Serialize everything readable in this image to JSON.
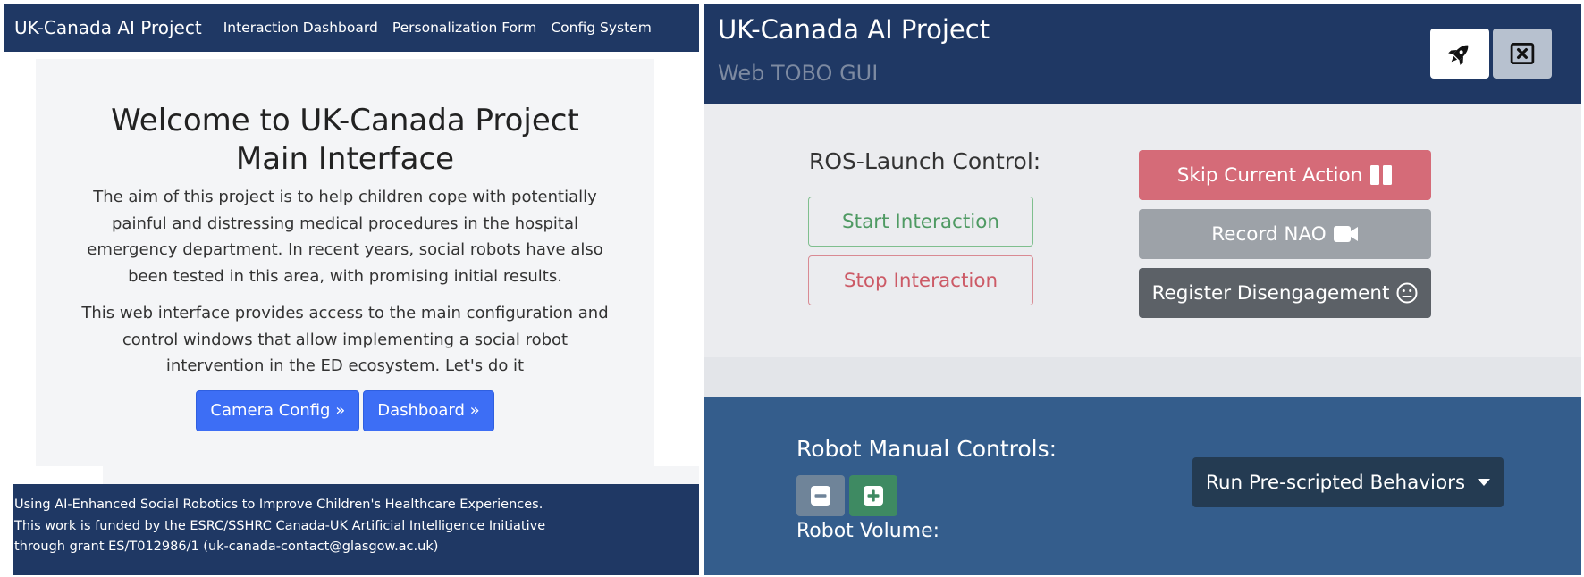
{
  "left": {
    "navbar": {
      "brand": "UK-Canada AI Project",
      "links": [
        "Interaction Dashboard",
        "Personalization Form",
        "Config System"
      ]
    },
    "jumbotron": {
      "title": "Welcome to UK-Canada Project Main Interface",
      "paragraph1": "The aim of this project is to help children cope with potentially painful and distressing medical procedures in the hospital emergency department. In recent years, social robots have also been tested in this area, with promising initial results.",
      "paragraph2": "This web interface provides access to the main configuration and control windows that allow implementing a social robot intervention in the ED ecosystem. Let's do it",
      "buttons": [
        "Camera Config »",
        "Dashboard »"
      ]
    },
    "footer": {
      "lines": [
        "Using AI-Enhanced Social Robotics to Improve Children's Healthcare Experiences.",
        "This work is funded by the ESRC/SSHRC Canada-UK Artificial Intelligence Initiative",
        "through grant ES/T012986/1 (uk-canada-contact@glasgow.ac.uk)"
      ]
    }
  },
  "right": {
    "header": {
      "title": "UK-Canada AI Project",
      "subtitle": "Web TOBO GUI",
      "icons": [
        "rocket-icon",
        "close-box-icon"
      ]
    },
    "ros_launch": {
      "label": "ROS-Launch Control:",
      "start_label": "Start Interaction",
      "stop_label": "Stop Interaction"
    },
    "actions": {
      "skip_label": "Skip Current Action",
      "record_label": "Record NAO",
      "register_label": "Register Disengagement"
    },
    "manual": {
      "label": "Robot Manual Controls:",
      "volume_label": "Robot Volume:",
      "dropdown_label": "Run Pre-scripted Behaviors"
    }
  },
  "colors": {
    "navy": "#1f3864",
    "primary": "#3d6ef5",
    "danger": "#d56b78",
    "secondary": "#9da2a8",
    "dark": "#5c6167",
    "manual_bg": "#345d8c"
  }
}
